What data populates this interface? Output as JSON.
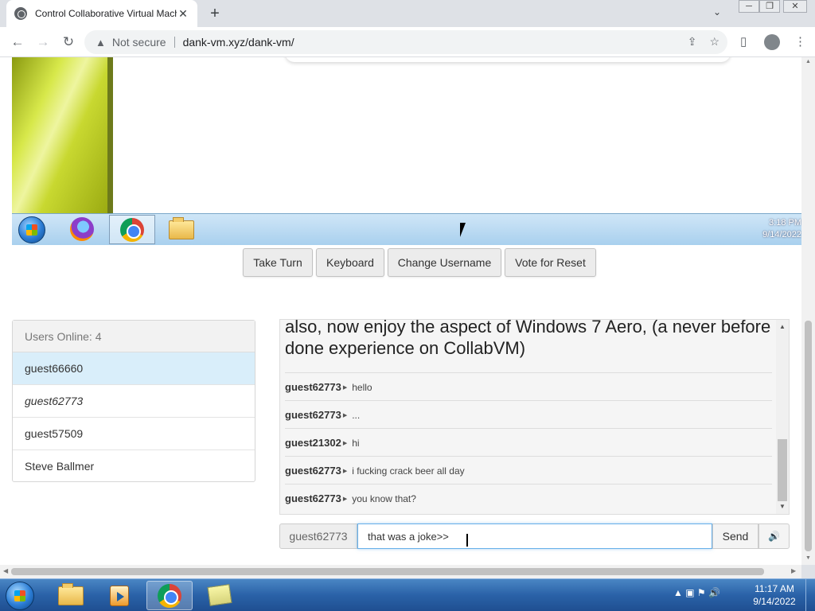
{
  "browser": {
    "tab_title": "Control Collaborative Virtual Machine",
    "tab_close": "✕",
    "new_tab": "+",
    "tab_menu": "⌄",
    "address": {
      "security_label": "Not secure",
      "url": "dank-vm.xyz/dank-vm/"
    }
  },
  "vm": {
    "clock_time": "3:18 PM",
    "clock_date": "9/14/2022"
  },
  "controls": {
    "take_turn": "Take Turn",
    "keyboard": "Keyboard",
    "change_username": "Change Username",
    "vote_reset": "Vote for Reset"
  },
  "users": {
    "header": "Users Online: 4",
    "list": [
      {
        "name": "guest66660"
      },
      {
        "name": "guest62773"
      },
      {
        "name": "guest57509"
      },
      {
        "name": "Steve Ballmer"
      }
    ]
  },
  "chat": {
    "banner": "also, now enjoy the aspect of Windows 7 Aero, (a never before done experience on CollabVM)",
    "messages": [
      {
        "user": "guest62773",
        "text": "hello"
      },
      {
        "user": "guest62773",
        "text": "..."
      },
      {
        "user": "guest21302",
        "text": "hi"
      },
      {
        "user": "guest62773",
        "text": "i fucking crack beer all day"
      },
      {
        "user": "guest62773",
        "text": "you know that?"
      }
    ],
    "username_label": "guest62773",
    "input_value": "that was a joke>>",
    "send_label": "Send",
    "sound_icon": "🔊"
  },
  "host_taskbar": {
    "clock_time": "11:17 AM",
    "clock_date": "9/14/2022"
  },
  "icons": {
    "back": "←",
    "forward": "→",
    "reload": "↻",
    "warning": "▲",
    "share": "⇪",
    "star": "☆",
    "sidepanel": "▯",
    "menu": "⋮",
    "minimize": "─",
    "restore": "❐",
    "close": "✕",
    "tray": "▲ ▣ ⚑ 🔊"
  }
}
